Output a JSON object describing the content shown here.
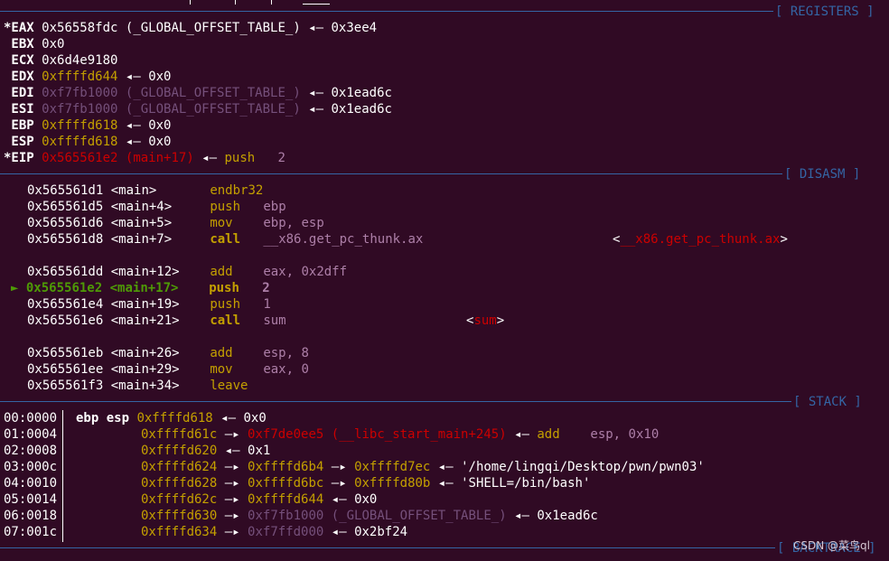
{
  "sections": {
    "registers": "[ REGISTERS ]",
    "disasm": "[ DISASM ]",
    "stack": "[ STACK ]",
    "backtrace": "[ BACKTRACE ]"
  },
  "registers": [
    {
      "name": "*EAX",
      "p1": "0x56558fdc",
      "p2": "(_GLOBAL_OFFSET_TABLE_)",
      "arrow": "◂—",
      "p3": "0x3ee4"
    },
    {
      "name": " EBX",
      "p1": "0x0"
    },
    {
      "name": " ECX",
      "p1": "0x6d4e9180"
    },
    {
      "name": " EDX",
      "p1": "0xffffd644",
      "arrow": "◂—",
      "p2": "0x0"
    },
    {
      "name": " EDI",
      "p1": "0xf7fb1000",
      "p2": "(_GLOBAL_OFFSET_TABLE_)",
      "arrow": "◂—",
      "p3": "0x1ead6c"
    },
    {
      "name": " ESI",
      "p1": "0xf7fb1000",
      "p2": "(_GLOBAL_OFFSET_TABLE_)",
      "arrow": "◂—",
      "p3": "0x1ead6c"
    },
    {
      "name": " EBP",
      "p1": "0xffffd618",
      "arrow": "◂—",
      "p2": "0x0"
    },
    {
      "name": " ESP",
      "p1": "0xffffd618",
      "arrow": "◂—",
      "p2": "0x0"
    },
    {
      "name": "*EIP",
      "p1": "0x565561e2",
      "p2": "(main+17)",
      "arrow": "◂—",
      "p3": "push",
      "p4": "2"
    }
  ],
  "disasm": [
    {
      "addr": "0x565561d1",
      "sym": "<main>",
      "op": "endbr32"
    },
    {
      "addr": "0x565561d5",
      "sym": "<main+4>",
      "op": "push",
      "args": "ebp"
    },
    {
      "addr": "0x565561d6",
      "sym": "<main+5>",
      "op": "mov",
      "args": "ebp, esp"
    },
    {
      "addr": "0x565561d8",
      "sym": "<main+7>",
      "op": "call",
      "args": "__x86.get_pc_thunk.ax",
      "lt": "<",
      "target": "__x86.get_pc_thunk.ax",
      "gt": ">"
    },
    {
      "addr": "0x565561dd",
      "sym": "<main+12>",
      "op": "add",
      "args": "eax, 0x2dff"
    },
    {
      "addr": "0x565561e2",
      "sym": "<main+17>",
      "op": "push",
      "args": "2"
    },
    {
      "addr": "0x565561e4",
      "sym": "<main+19>",
      "op": "push",
      "args": "1"
    },
    {
      "addr": "0x565561e6",
      "sym": "<main+21>",
      "op": "call",
      "args": "sum",
      "lt": "<",
      "target": "sum",
      "gt": ">"
    },
    {
      "addr": "0x565561eb",
      "sym": "<main+26>",
      "op": "add",
      "args": "esp, 8"
    },
    {
      "addr": "0x565561ee",
      "sym": "<main+29>",
      "op": "mov",
      "args": "eax, 0"
    },
    {
      "addr": "0x565561f3",
      "sym": "<main+34>",
      "op": "leave"
    }
  ],
  "stack": [
    {
      "idx": "00:0000",
      "regs": "ebp esp",
      "addr": "0xffffd618",
      "arrow": "◂—",
      "v1": "0x0"
    },
    {
      "idx": "01:0004",
      "addr": "0xffffd61c",
      "arrow": "—▸",
      "v1": "0xf7de0ee5",
      "v2": "(__libc_start_main+245)",
      "arrow2": "◂—",
      "op": "add",
      "args": "esp, 0x10"
    },
    {
      "idx": "02:0008",
      "addr": "0xffffd620",
      "arrow": "◂—",
      "v1": "0x1"
    },
    {
      "idx": "03:000c",
      "addr": "0xffffd624",
      "arrow": "—▸",
      "v1": "0xffffd6b4",
      "arrow2": "—▸",
      "v2": "0xffffd7ec",
      "arrow3": "◂—",
      "v3": "'/home/lingqi/Desktop/pwn/pwn03'"
    },
    {
      "idx": "04:0010",
      "addr": "0xffffd628",
      "arrow": "—▸",
      "v1": "0xffffd6bc",
      "arrow2": "—▸",
      "v2": "0xffffd80b",
      "arrow3": "◂—",
      "v3": "'SHELL=/bin/bash'"
    },
    {
      "idx": "05:0014",
      "addr": "0xffffd62c",
      "arrow": "—▸",
      "v1": "0xffffd644",
      "arrow2": "◂—",
      "v2": "0x0"
    },
    {
      "idx": "06:0018",
      "addr": "0xffffd630",
      "arrow": "—▸",
      "v1": "0xf7fb1000",
      "v2": "(_GLOBAL_OFFSET_TABLE_)",
      "arrow2": "◂—",
      "v3": "0x1ead6c"
    },
    {
      "idx": "07:001c",
      "addr": "0xffffd634",
      "arrow": "—▸",
      "v1": "0xf7ffd000",
      "arrow2": "◂—",
      "v2": "0x2bf24"
    }
  ],
  "watermark": "CSDN @菜鸟ql",
  "colors": {
    "background": "#300a24",
    "separator": "#3465a4",
    "address_yellow": "#c4a000",
    "symbol_red": "#cc0000",
    "current_green": "#4e9a06",
    "mapped_purple": "#75507b",
    "operand_lilac": "#ad7fa8"
  }
}
